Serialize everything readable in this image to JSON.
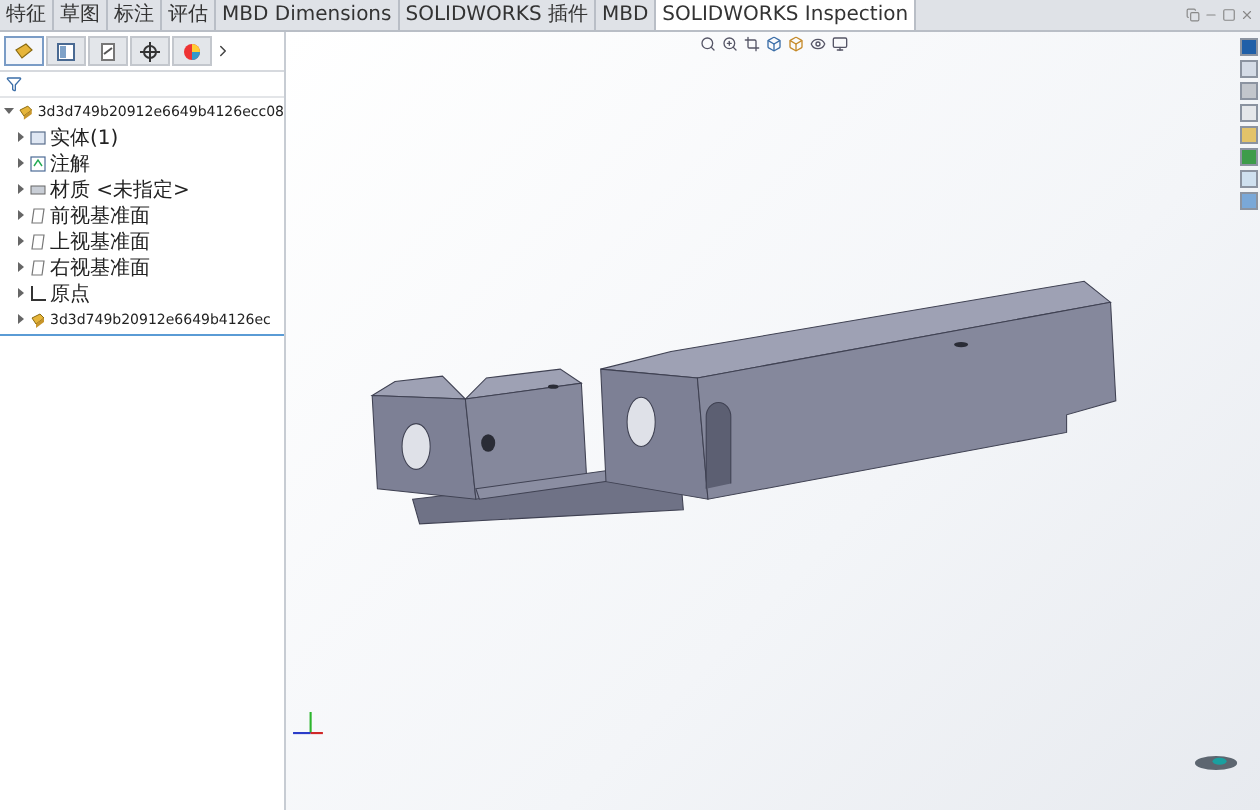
{
  "command_tabs": [
    {
      "label": "特征",
      "selected": false
    },
    {
      "label": "草图",
      "selected": false
    },
    {
      "label": "标注",
      "selected": false
    },
    {
      "label": "评估",
      "selected": false
    },
    {
      "label": "MBD Dimensions",
      "selected": false
    },
    {
      "label": "SOLIDWORKS 插件",
      "selected": false
    },
    {
      "label": "MBD",
      "selected": false
    },
    {
      "label": "SOLIDWORKS Inspection",
      "selected": true
    }
  ],
  "panel_tabs": [
    {
      "kind": "feature",
      "selected": true
    },
    {
      "kind": "property",
      "selected": false
    },
    {
      "kind": "config",
      "selected": false
    },
    {
      "kind": "dim",
      "selected": false
    },
    {
      "kind": "display",
      "selected": false
    }
  ],
  "tree": [
    {
      "label": "3d3d749b20912e6649b4126ecc08",
      "kind": "part",
      "expanded": true,
      "selected": false,
      "children": [
        {
          "label": "实体(1)",
          "kind": "solid",
          "expanded": false,
          "selected": false
        },
        {
          "label": "注解",
          "kind": "note",
          "expanded": false,
          "selected": false
        },
        {
          "label": "材质 <未指定>",
          "kind": "material",
          "expanded": false,
          "selected": false
        },
        {
          "label": "前视基准面",
          "kind": "plane",
          "expanded": false,
          "selected": false
        },
        {
          "label": "上视基准面",
          "kind": "plane",
          "expanded": false,
          "selected": false
        },
        {
          "label": "右视基准面",
          "kind": "plane",
          "expanded": false,
          "selected": false
        },
        {
          "label": "原点",
          "kind": "origin",
          "expanded": false,
          "selected": false
        },
        {
          "label": "3d3d749b20912e6649b4126ec",
          "kind": "part",
          "expanded": false,
          "selected": false
        }
      ]
    }
  ]
}
